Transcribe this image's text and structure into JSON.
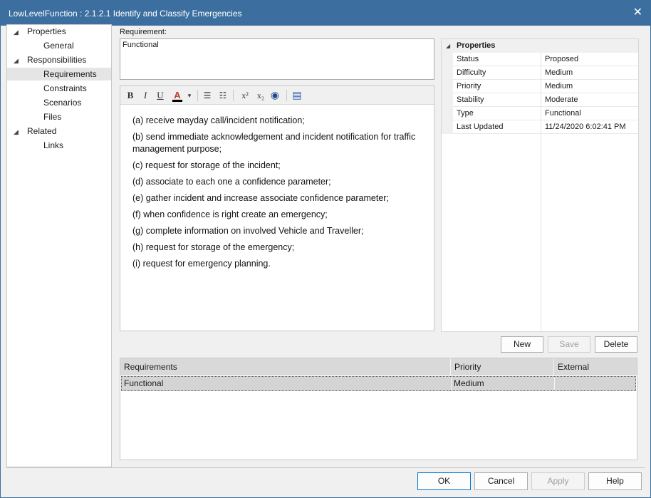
{
  "window": {
    "title": "LowLevelFunction : 2.1.2.1 Identify and Classify Emergencies",
    "close_glyph": "✕"
  },
  "tree": [
    {
      "label": "Properties",
      "level": 0,
      "expanded": true
    },
    {
      "label": "General",
      "level": 1
    },
    {
      "label": "Responsibilities",
      "level": 0,
      "expanded": true
    },
    {
      "label": "Requirements",
      "level": 1,
      "selected": true
    },
    {
      "label": "Constraints",
      "level": 1
    },
    {
      "label": "Scenarios",
      "level": 1
    },
    {
      "label": "Files",
      "level": 1
    },
    {
      "label": "Related",
      "level": 0,
      "expanded": true
    },
    {
      "label": "Links",
      "level": 1
    }
  ],
  "requirement": {
    "label": "Requirement:",
    "value": "Functional"
  },
  "toolbar": {
    "bold": "B",
    "italic": "I",
    "underline": "U",
    "font_color": "A",
    "dropdown": "▾",
    "bullets": "☰",
    "numbering": "☷",
    "superscript": "x²",
    "subscript": "x₂",
    "hyperlink": "◉",
    "document": "▤",
    "font_color_value": "#000000",
    "font_color_icon_color": "#c0392b"
  },
  "notes": [
    "(a) receive mayday call/incident notification;",
    "(b) send immediate acknowledgement and incident notification for traffic management purpose;",
    "(c) request for storage of the incident;",
    "(d) associate to each one a confidence parameter;",
    "(e) gather incident and increase associate confidence parameter;",
    "(f) when confidence is right create an emergency;",
    "(g) complete information on involved Vehicle and Traveller;",
    "(h) request for storage of the emergency;",
    "(i) request for emergency planning."
  ],
  "properties": {
    "header": "Properties",
    "rows": [
      {
        "name": "Status",
        "value": "Proposed"
      },
      {
        "name": "Difficulty",
        "value": "Medium"
      },
      {
        "name": "Priority",
        "value": "Medium"
      },
      {
        "name": "Stability",
        "value": "Moderate"
      },
      {
        "name": "Type",
        "value": "Functional"
      },
      {
        "name": "Last Updated",
        "value": "11/24/2020 6:02:41 PM"
      }
    ]
  },
  "actions": {
    "new": "New",
    "save": "Save",
    "delete": "Delete"
  },
  "grid": {
    "columns": [
      "Requirements",
      "Priority",
      "External"
    ],
    "rows": [
      {
        "requirement": "Functional",
        "priority": "Medium",
        "external": ""
      }
    ]
  },
  "footer": {
    "ok": "OK",
    "cancel": "Cancel",
    "apply": "Apply",
    "help": "Help"
  },
  "colors": {
    "titlebar": "#3c6f9f",
    "selection": "#e5e5e5",
    "grid_header": "#d9d9d9"
  }
}
